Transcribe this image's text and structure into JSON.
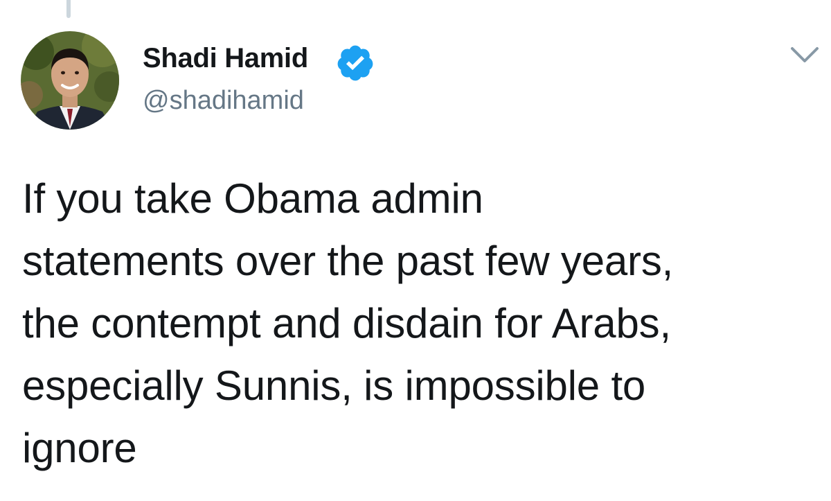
{
  "tweet": {
    "author": {
      "name": "Shadi Hamid",
      "handle": "@shadihamid",
      "verified": true,
      "avatar_icon": "profile-photo"
    },
    "text_lines": [
      "If you take Obama admin",
      "statements over the past few years,",
      "the contempt and disdain for Arabs,",
      "especially Sunnis, is impossible to",
      "ignore"
    ],
    "menu_icon": "chevron-down-icon"
  },
  "colors": {
    "text": "#14171a",
    "handle": "#657786",
    "verified_badge": "#1da1f2",
    "thread_line": "#ccd6dd"
  }
}
